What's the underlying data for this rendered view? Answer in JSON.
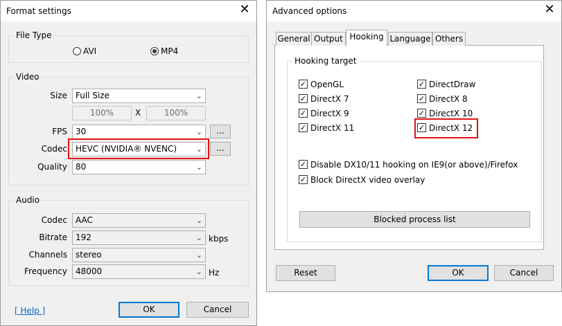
{
  "format_window": {
    "title": "Format settings",
    "close_glyph": "✕",
    "file_type": {
      "legend": "File Type",
      "options": [
        "AVI",
        "MP4"
      ],
      "selected": "MP4"
    },
    "video": {
      "legend": "Video",
      "size_label": "Size",
      "size_value": "Full Size",
      "width_pct": "100%",
      "x_label": "X",
      "height_pct": "100%",
      "fps_label": "FPS",
      "fps_value": "30",
      "codec_label": "Codec",
      "codec_value": "HEVC (NVIDIA® NVENC)",
      "quality_label": "Quality",
      "quality_value": "80",
      "more_label": "..."
    },
    "audio": {
      "legend": "Audio",
      "codec_label": "Codec",
      "codec_value": "AAC",
      "bitrate_label": "Bitrate",
      "bitrate_value": "192",
      "bitrate_unit": "kbps",
      "channels_label": "Channels",
      "channels_value": "stereo",
      "frequency_label": "Frequency",
      "frequency_value": "48000",
      "frequency_unit": "Hz"
    },
    "help_label": "[ Help ]",
    "ok_label": "OK",
    "cancel_label": "Cancel"
  },
  "advanced_window": {
    "title": "Advanced options",
    "close_glyph": "✕",
    "tabs": [
      "General",
      "Output",
      "Hooking",
      "Language",
      "Others"
    ],
    "active_tab": "Hooking",
    "hooking_target": {
      "legend": "Hooking target",
      "left": [
        {
          "label": "OpenGL",
          "checked": true
        },
        {
          "label": "DirectX 7",
          "checked": true
        },
        {
          "label": "DirectX 9",
          "checked": true
        },
        {
          "label": "DirectX 11",
          "checked": true
        }
      ],
      "right": [
        {
          "label": "DirectDraw",
          "checked": true
        },
        {
          "label": "DirectX 8",
          "checked": true
        },
        {
          "label": "DirectX 10",
          "checked": true
        },
        {
          "label": "DirectX 12",
          "checked": true
        }
      ],
      "disable_dx": {
        "label": "Disable DX10/11 hooking on IE9(or above)/Firefox",
        "checked": true
      },
      "block_overlay": {
        "label": "Block DirectX video overlay",
        "checked": true
      },
      "blocked_list_label": "Blocked process list"
    },
    "reset_label": "Reset",
    "ok_label": "OK",
    "cancel_label": "Cancel"
  },
  "colors": {
    "highlight": "#e21010",
    "default_button_border": "#0078d7",
    "link": "#0066cc"
  },
  "check_glyph": "✓",
  "chevron_glyph": "⌄"
}
